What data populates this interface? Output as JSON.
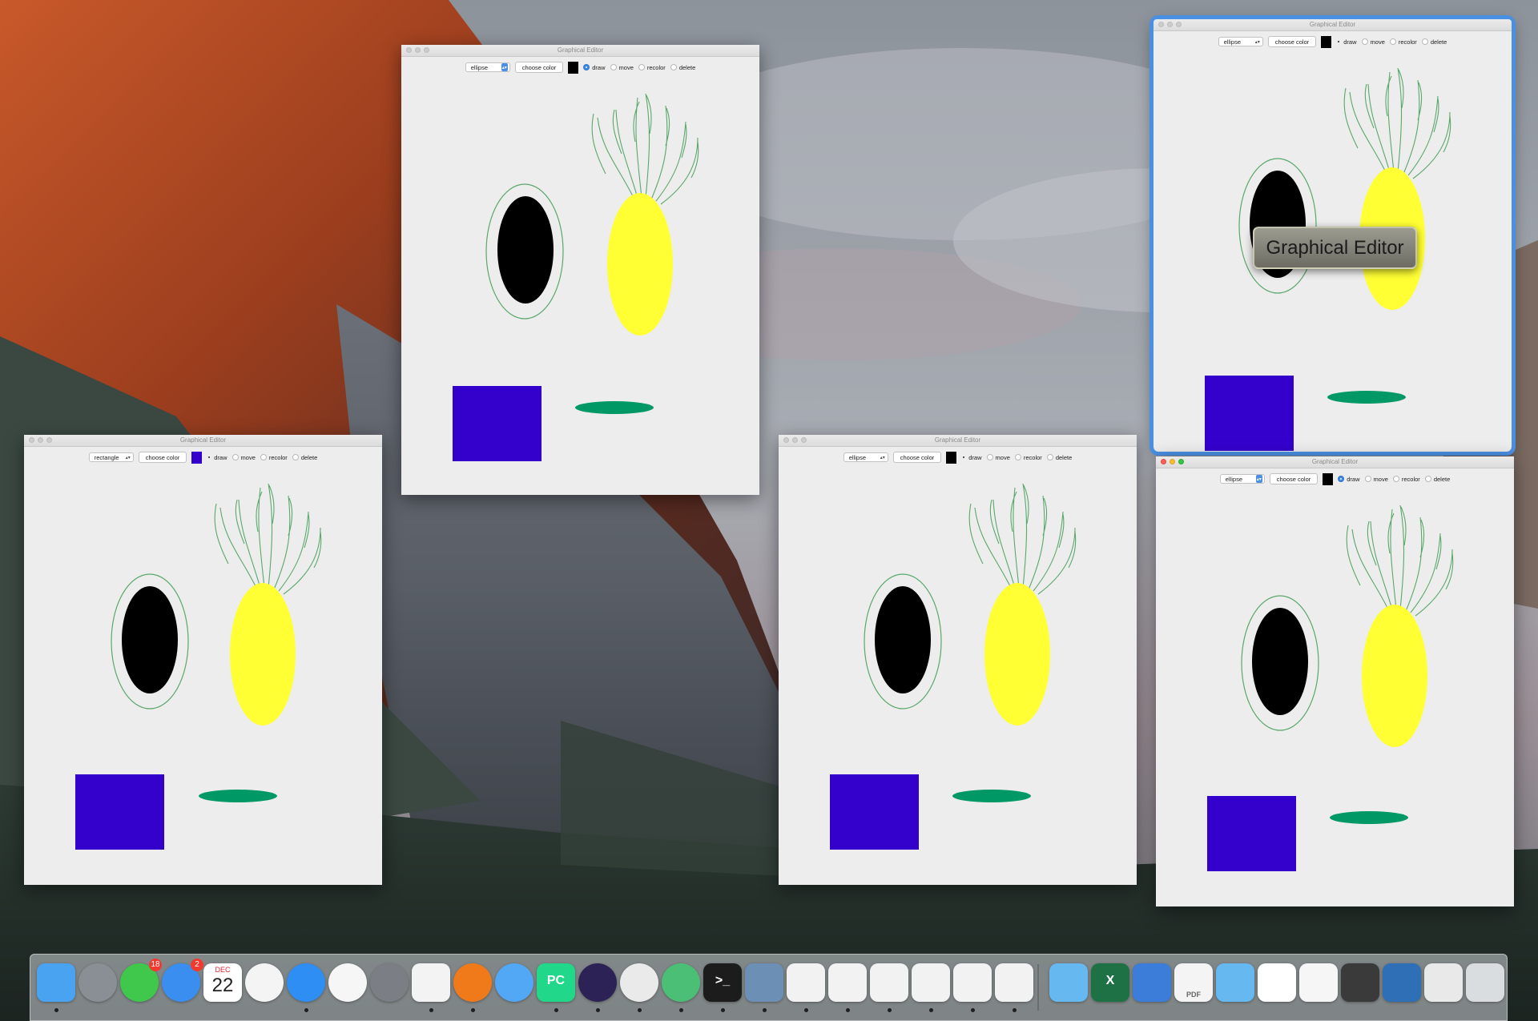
{
  "desktop": {
    "wallpaper": "El Capitan"
  },
  "editor": {
    "title": "Graphical Editor",
    "choose_color_label": "choose color",
    "radio_labels": [
      "draw",
      "move",
      "recolor",
      "delete"
    ],
    "colors": {
      "black": "#000000",
      "yellow": "#ffff33",
      "blue": "#3300cc",
      "green": "#009966",
      "stroke_green": "#5aa86a",
      "canvas": "#eeeeee"
    }
  },
  "windows": [
    {
      "id": "top-center",
      "shape": "ellipse",
      "color": "#000000",
      "radio_style": "selected"
    },
    {
      "id": "left",
      "shape": "rectangle",
      "color": "#3300cc",
      "radio_style": "plain"
    },
    {
      "id": "middle-right",
      "shape": "ellipse",
      "color": "#000000",
      "radio_style": "plain"
    },
    {
      "id": "top-right",
      "shape": "ellipse",
      "color": "#000000",
      "radio_style": "plain"
    },
    {
      "id": "bottom-right",
      "shape": "ellipse",
      "color": "#000000",
      "radio_style": "selected"
    }
  ],
  "tooltip": {
    "text": "Graphical Editor"
  },
  "dock": {
    "items": [
      {
        "name": "finder-icon",
        "color": "#4aa3f0",
        "running": true
      },
      {
        "name": "launchpad-icon",
        "color": "#8a8f96",
        "running": false
      },
      {
        "name": "facetime-icon",
        "color": "#3fc84c",
        "running": false,
        "badge": "18"
      },
      {
        "name": "app-store-icon",
        "color": "#3a8ef0",
        "running": false,
        "badge": "2"
      },
      {
        "name": "calendar-icon",
        "color": "#ffffff",
        "running": false,
        "month": "DEC",
        "day": "22"
      },
      {
        "name": "photos-icon",
        "color": "#f4f4f4",
        "running": false
      },
      {
        "name": "safari-icon",
        "color": "#2f8ef3",
        "running": true
      },
      {
        "name": "itunes-icon",
        "color": "#f6f6f6",
        "running": false
      },
      {
        "name": "system-preferences-icon",
        "color": "#7b7f85",
        "running": false
      },
      {
        "name": "textedit-icon",
        "color": "#f3f3f3",
        "running": true
      },
      {
        "name": "firefox-icon",
        "color": "#f07a1a",
        "running": true
      },
      {
        "name": "messages-icon",
        "color": "#53a8f5",
        "running": false
      },
      {
        "name": "pycharm-icon",
        "color": "#21d789",
        "running": true,
        "label": "PC"
      },
      {
        "name": "eclipse-icon",
        "color": "#2c2255",
        "running": true
      },
      {
        "name": "chrome-icon",
        "color": "#eaeaea",
        "running": true
      },
      {
        "name": "atom-icon",
        "color": "#4bbf76",
        "running": true
      },
      {
        "name": "terminal-icon",
        "color": "#1c1c1c",
        "running": true,
        "label": ">_"
      },
      {
        "name": "preview-icon",
        "color": "#6b8fb5",
        "running": true
      },
      {
        "name": "java-app-icon",
        "color": "#f2f2f2",
        "running": true
      },
      {
        "name": "java-app-icon",
        "color": "#f2f2f2",
        "running": true
      },
      {
        "name": "java-app-icon",
        "color": "#f2f2f2",
        "running": true
      },
      {
        "name": "java-app-icon",
        "color": "#f2f2f2",
        "running": true
      },
      {
        "name": "java-app-icon",
        "color": "#f2f2f2",
        "running": true
      },
      {
        "name": "java-app-icon",
        "color": "#f2f2f2",
        "running": true
      },
      {
        "name": "folder-icon",
        "color": "#66b8f0",
        "running": false
      },
      {
        "name": "excel-icon",
        "color": "#1e7145",
        "running": false,
        "label": "X"
      },
      {
        "name": "keynote-icon",
        "color": "#3b7dd8",
        "running": false
      },
      {
        "name": "pdf-document-icon",
        "color": "#f4f4f4",
        "running": false,
        "label": "PDF"
      },
      {
        "name": "folder-icon",
        "color": "#66b8f0",
        "running": false
      },
      {
        "name": "document-thumbnail-icon",
        "color": "#ffffff",
        "running": false
      },
      {
        "name": "document-thumbnail-icon",
        "color": "#f6f6f6",
        "running": false
      },
      {
        "name": "image-stack-icon",
        "color": "#3a3a3a",
        "running": false
      },
      {
        "name": "phone-screenshot-icon",
        "color": "#2e6fb5",
        "running": false
      },
      {
        "name": "window-thumbnail-icon",
        "color": "#e9e9e9",
        "running": false
      },
      {
        "name": "trash-icon",
        "color": "#d9dde0",
        "running": false
      }
    ]
  }
}
